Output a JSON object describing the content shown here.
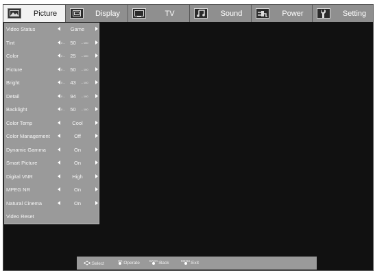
{
  "tabs": [
    {
      "label": "Picture",
      "icon": "picture-icon",
      "active": true
    },
    {
      "label": "Display",
      "icon": "display-icon",
      "active": false
    },
    {
      "label": "TV",
      "icon": "tv-icon",
      "active": false
    },
    {
      "label": "Sound",
      "icon": "music-note-icon",
      "active": false
    },
    {
      "label": "Power",
      "icon": "power-plug-icon",
      "active": false
    },
    {
      "label": "Setting",
      "icon": "wrench-icon",
      "active": false
    }
  ],
  "menu": [
    {
      "label": "Video Status",
      "type": "select",
      "value": "Game"
    },
    {
      "label": "Tint",
      "type": "slider",
      "value": "50",
      "min": "0 –",
      "max": "– 100"
    },
    {
      "label": "Color",
      "type": "slider",
      "value": "25",
      "min": "0 –",
      "max": "– 100"
    },
    {
      "label": "Picture",
      "type": "slider",
      "value": "50",
      "min": "0 –",
      "max": "– 100"
    },
    {
      "label": "Bright",
      "type": "slider",
      "value": "43",
      "min": "0 –",
      "max": "– 100"
    },
    {
      "label": "Detail",
      "type": "slider",
      "value": "94",
      "min": "0 –",
      "max": "– 100"
    },
    {
      "label": "Backlight",
      "type": "slider",
      "value": "50",
      "min": "0 –",
      "max": "– 100"
    },
    {
      "label": "Color Temp",
      "type": "select",
      "value": "Cool"
    },
    {
      "label": "Color Management",
      "type": "select",
      "value": "Off"
    },
    {
      "label": "Dynamic Gamma",
      "type": "select",
      "value": "On"
    },
    {
      "label": "Smart Picture",
      "type": "select",
      "value": "On"
    },
    {
      "label": "Digital VNR",
      "type": "select",
      "value": "High"
    },
    {
      "label": "MPEG NR",
      "type": "select",
      "value": "On"
    },
    {
      "label": "Natural Cinema",
      "type": "select",
      "value": "On"
    },
    {
      "label": "Video Reset",
      "type": "action",
      "value": ""
    }
  ],
  "hints": {
    "select": ":Select",
    "ok_key": "OK",
    "operate": ":Operate",
    "back_key": "BACK",
    "back": ":Back",
    "menu_key": "MENU",
    "exit": ":Exit"
  },
  "colors": {
    "screen": "#111111",
    "panel": "#9a9a9a",
    "active_tab": "#f2f2f2"
  }
}
